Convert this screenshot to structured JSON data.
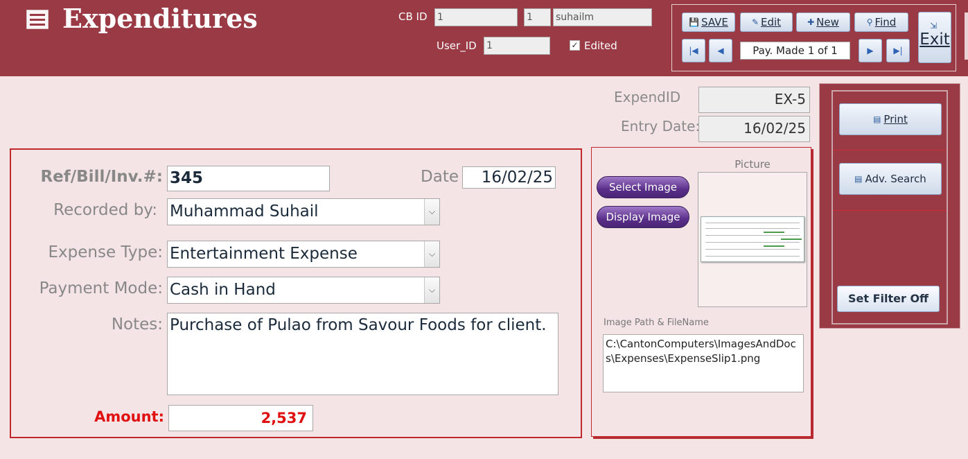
{
  "header": {
    "title": "Expenditures",
    "cb_id_label": "CB ID",
    "cb_id_value": "1",
    "cb_id_value2": "1",
    "username": "suhailm",
    "user_id_label": "User_ID",
    "user_id_value": "1",
    "edited_label": "Edited",
    "edited_checked": true
  },
  "toolbar": {
    "save": "SAVE",
    "edit": "Edit",
    "new": "New",
    "find": "Find",
    "record_nav": "Pay. Made 1 of 1",
    "exit": "Exit"
  },
  "record": {
    "expend_id_label": "ExpendID",
    "expend_id": "EX-5",
    "entry_date_label": "Entry Date:",
    "entry_date": "16/02/25"
  },
  "form": {
    "ref_label": "Ref/Bill/Inv.#:",
    "ref_value": "345",
    "date_label": "Date",
    "date_value": "16/02/25",
    "recorded_by_label": "Recorded by:",
    "recorded_by_value": "Muhammad Suhail",
    "expense_type_label": "Expense Type:",
    "expense_type_value": "Entertainment Expense",
    "payment_mode_label": "Payment Mode:",
    "payment_mode_value": "Cash in Hand",
    "notes_label": "Notes:",
    "notes_value": "Purchase of Pulao from Savour Foods for client.",
    "amount_label": "Amount:",
    "amount_value": "2,537"
  },
  "picture": {
    "select_image": "Select Image",
    "display_image": "Display Image",
    "picture_label": "Picture",
    "path_label": "Image Path & FileName",
    "path_value": "C:\\CantonComputers\\ImagesAndDocs\\Expenses\\ExpenseSlip1.png"
  },
  "side": {
    "print": "Print",
    "adv_search": "Adv. Search",
    "filter_off": "Set Filter Off"
  },
  "colors": {
    "header_bg": "#9a3a45",
    "body_bg": "#f5e4e5",
    "frame_red": "#c0272d",
    "amount_red": "#e01010"
  }
}
